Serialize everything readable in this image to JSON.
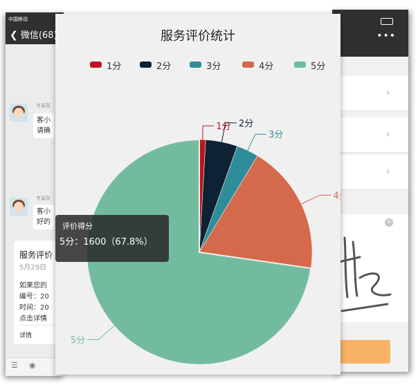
{
  "left_phone": {
    "carrier": "中国移动",
    "back_label": "微信(68)",
    "messages": [
      {
        "sender": "专属客",
        "text_line1": "客小",
        "text_line2": "请确"
      },
      {
        "sender": "专属客",
        "text_line1": "客小",
        "text_line2": "好的"
      }
    ],
    "card": {
      "title": "服务评价",
      "date": "5月29日",
      "lines": [
        "如果您的",
        "编号：20",
        "时间：20",
        "点击详情"
      ],
      "detail": "详情"
    }
  },
  "chart_data": {
    "type": "pie",
    "title": "服务评价统计",
    "categories": [
      "1分",
      "2分",
      "3分",
      "4分",
      "5分"
    ],
    "values": [
      20,
      100,
      70,
      410,
      1600
    ],
    "colors": [
      "#c1121f",
      "#0d2233",
      "#2f8c99",
      "#d4694b",
      "#73bb9e"
    ],
    "legend_position": "top"
  },
  "tooltip": {
    "title": "评价得分",
    "text": "5分：1600（67.8%）"
  }
}
